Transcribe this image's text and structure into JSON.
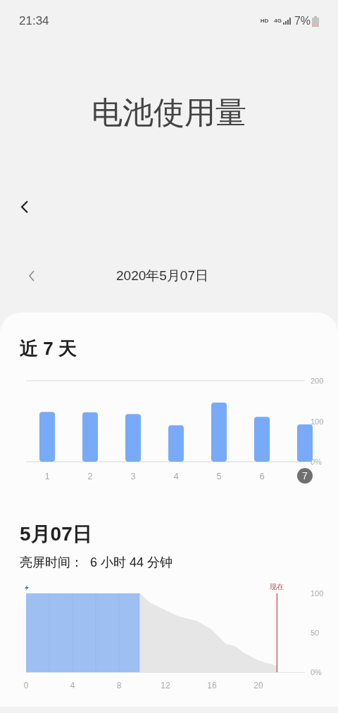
{
  "status_bar": {
    "time": "21:34",
    "hd": "HD",
    "network": "4G",
    "battery": "7%"
  },
  "title": "电池使用量",
  "date_nav": {
    "date": "2020年5月07日"
  },
  "week": {
    "title": "近 7 天",
    "chart_data": {
      "type": "bar",
      "categories": [
        "1",
        "2",
        "3",
        "4",
        "5",
        "6",
        "7"
      ],
      "series": [
        {
          "color": "#78aaf8",
          "values": [
            123,
            122,
            118,
            90,
            146,
            111,
            92
          ]
        }
      ],
      "ylim": [
        0,
        200
      ],
      "yticks": [
        {
          "value": 200,
          "label": "200"
        },
        {
          "value": 100,
          "label": "100"
        },
        {
          "value": 0,
          "label": "0%"
        }
      ]
    },
    "category_selected": [
      false,
      false,
      false,
      false,
      false,
      false,
      true
    ]
  },
  "day": {
    "title": "5月07日",
    "screen_time": "亮屏时间：  6 小时 44 分钟",
    "chart_data": {
      "type": "area",
      "x": [
        0,
        9.8,
        10.7,
        13.1,
        14.7,
        15.9,
        17.2,
        18,
        18.8,
        20,
        21.6
      ],
      "series": [
        {
          "color": "#9dbff2",
          "values": [
            100,
            100,
            null,
            null,
            null,
            null,
            null,
            null,
            null,
            null,
            null
          ]
        },
        {
          "color": "#e6e6e6",
          "values": [
            null,
            100,
            88,
            71,
            65,
            55,
            36,
            33,
            24,
            15,
            8
          ]
        }
      ],
      "xlim": [
        0,
        24
      ],
      "ylim": [
        0,
        100
      ],
      "xticks": [
        0,
        4,
        8,
        12,
        16,
        20
      ],
      "yticks": [
        {
          "value": 100,
          "label": "100"
        },
        {
          "value": 50,
          "label": "50"
        },
        {
          "value": 0,
          "label": "0%"
        }
      ],
      "annotations": [
        {
          "x": 21.6,
          "text": "现在"
        }
      ]
    }
  }
}
